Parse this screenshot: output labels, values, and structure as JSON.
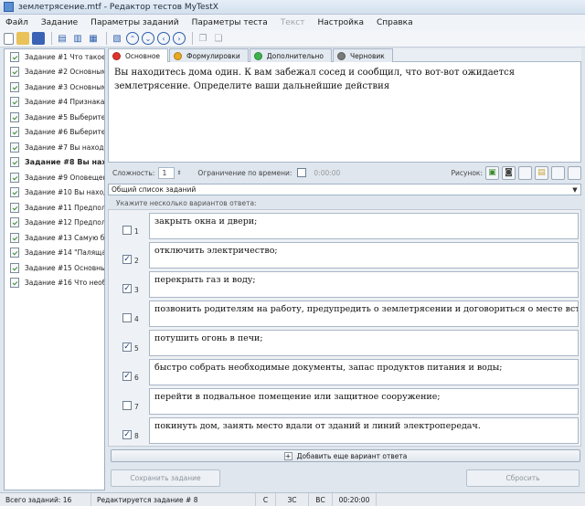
{
  "window": {
    "title": "землетрясение.mtf - Редактор тестов MyTestX"
  },
  "menu": [
    {
      "label": "Файл",
      "enabled": true
    },
    {
      "label": "Задание",
      "enabled": true
    },
    {
      "label": "Параметры заданий",
      "enabled": true
    },
    {
      "label": "Параметры теста",
      "enabled": true
    },
    {
      "label": "Текст",
      "enabled": false
    },
    {
      "label": "Настройка",
      "enabled": true
    },
    {
      "label": "Справка",
      "enabled": true
    }
  ],
  "tasks": [
    {
      "label": "Задание #1 Что такое з",
      "active": false
    },
    {
      "label": "Задание #2 Основным",
      "active": false
    },
    {
      "label": "Задание #3 Основными",
      "active": false
    },
    {
      "label": "Задание #4 Признаками",
      "active": false
    },
    {
      "label": "Задание #5 Выберите н",
      "active": false
    },
    {
      "label": "Задание #6 Выберите и",
      "active": false
    },
    {
      "label": "Задание #7 Вы находит",
      "active": false
    },
    {
      "label": "Задание #8 Вы наход",
      "active": true
    },
    {
      "label": "Задание #9 Оповещен",
      "active": false
    },
    {
      "label": "Задание #10 Вы находи",
      "active": false
    },
    {
      "label": "Задание #11 Предполож",
      "active": false
    },
    {
      "label": "Задание #12 Предполож",
      "active": false
    },
    {
      "label": "Задание #13 Самую бол",
      "active": false
    },
    {
      "label": "Задание #14 \"Палящая",
      "active": false
    },
    {
      "label": "Задание #15 Основным",
      "active": false
    },
    {
      "label": "Задание #16 Что необх",
      "active": false
    }
  ],
  "tabs": [
    {
      "label": "Основное",
      "color": "#e0332b",
      "active": true
    },
    {
      "label": "Формулировки",
      "color": "#e8a820",
      "active": false
    },
    {
      "label": "Дополнительно",
      "color": "#3bb34a",
      "active": false
    },
    {
      "label": "Черновик",
      "color": "#7a7a7a",
      "active": false
    }
  ],
  "question": {
    "text": "Вы находитесь дома один. К вам забежал сосед и сообщил, что вот-вот ожидается землетрясение. Определите ваши дальнейшие действия"
  },
  "params": {
    "difficulty_label": "Сложность:",
    "difficulty_value": "1",
    "time_limit_label": "Ограничение по времени:",
    "time_value": "0:00:00",
    "picture_label": "Рисунок:"
  },
  "combo": {
    "value": "Общий список заданий"
  },
  "hint": "Укажите несколько вариантов ответа:",
  "answers": [
    {
      "num": "1",
      "checked": false,
      "text": "закрыть окна и двери;"
    },
    {
      "num": "2",
      "checked": true,
      "text": "отключить электричество;"
    },
    {
      "num": "3",
      "checked": true,
      "text": "перекрыть газ и воду;"
    },
    {
      "num": "4",
      "checked": false,
      "text": "позвонить родителям на работу, предупредить о землетрясении и договориться о месте встречи;"
    },
    {
      "num": "5",
      "checked": true,
      "text": "потушить огонь в печи;"
    },
    {
      "num": "6",
      "checked": true,
      "text": "быстро собрать необходимые документы, запас продуктов питания и воды;"
    },
    {
      "num": "7",
      "checked": false,
      "text": "перейти в подвальное помещение или защитное сооружение;"
    },
    {
      "num": "8",
      "checked": true,
      "text": "покинуть дом, занять место вдали от зданий и линий электропередач."
    }
  ],
  "buttons": {
    "add": "Добавить еще вариант ответа",
    "save": "Сохранить задание",
    "reset": "Сбросить"
  },
  "status": {
    "total": "Всего заданий: 16",
    "editing": "Редактируется задание # 8",
    "c": "C",
    "zs": "ЗС",
    "vs": "ВС",
    "time": "00:20:00"
  }
}
